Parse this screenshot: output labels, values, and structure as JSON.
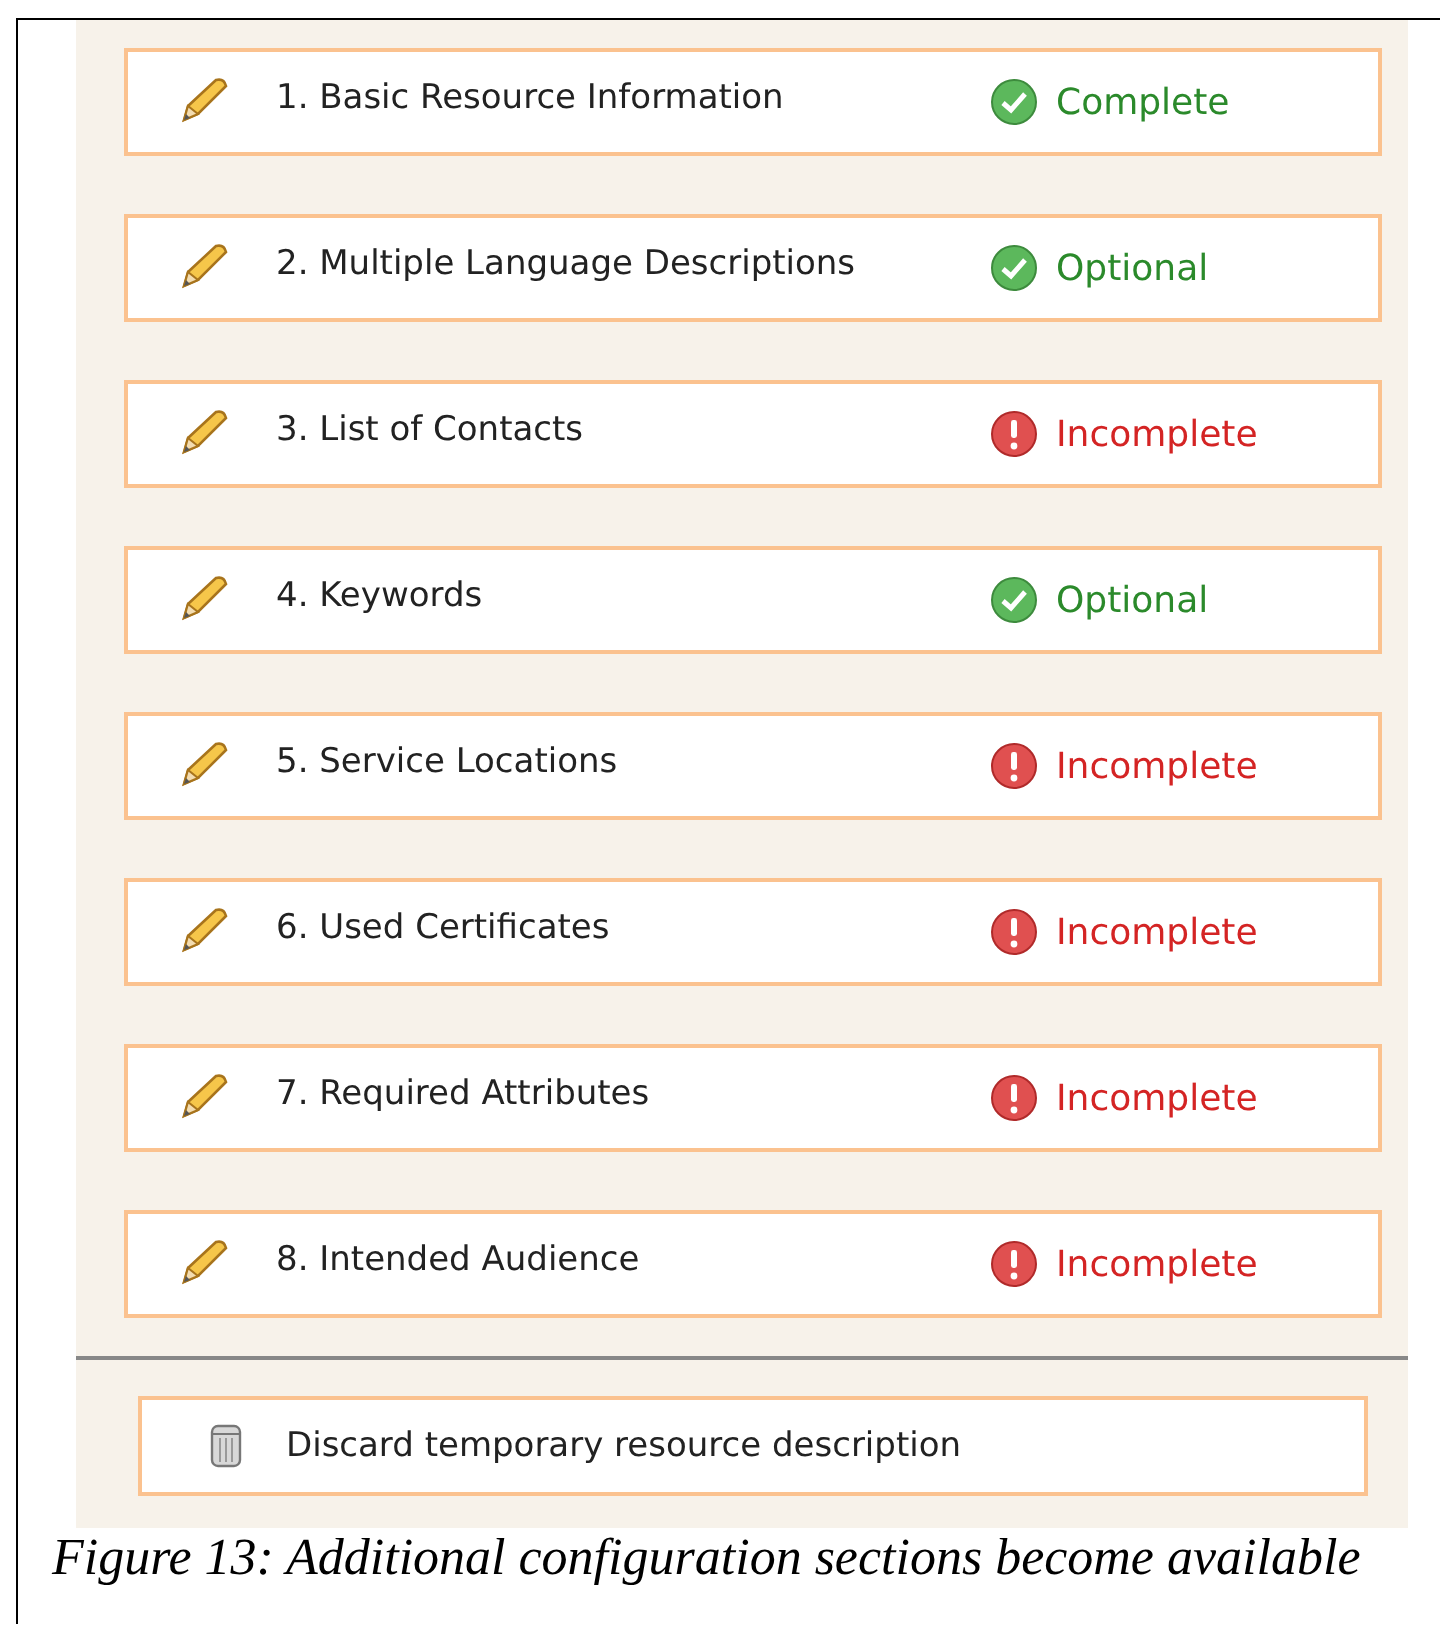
{
  "sections": [
    {
      "label": "1. Basic Resource Information",
      "status": "Complete",
      "kind": "ok"
    },
    {
      "label": "2. Multiple Language Descriptions",
      "status": "Optional",
      "kind": "ok"
    },
    {
      "label": "3. List of Contacts",
      "status": "Incomplete",
      "kind": "error"
    },
    {
      "label": "4. Keywords",
      "status": "Optional",
      "kind": "ok"
    },
    {
      "label": "5. Service Locations",
      "status": "Incomplete",
      "kind": "error"
    },
    {
      "label": "6. Used Certificates",
      "status": "Incomplete",
      "kind": "error"
    },
    {
      "label": "7. Required Attributes",
      "status": "Incomplete",
      "kind": "error"
    },
    {
      "label": "8. Intended Audience",
      "status": "Incomplete",
      "kind": "error"
    }
  ],
  "discard_button": {
    "label": "Discard temporary resource description"
  },
  "caption": "Figure 13: Additional configuration sections become available"
}
